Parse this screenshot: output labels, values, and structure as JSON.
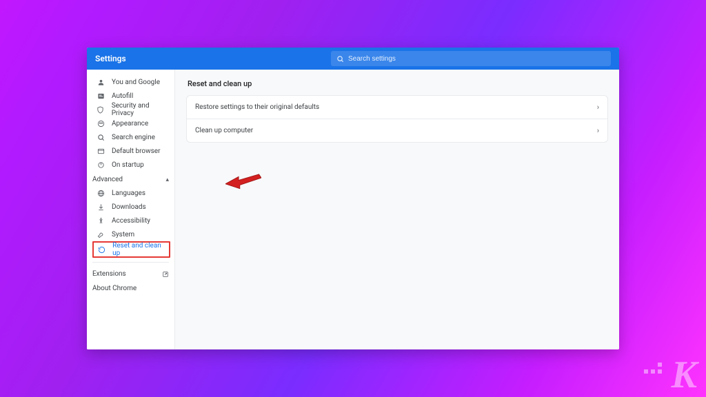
{
  "header": {
    "title": "Settings",
    "search_placeholder": "Search settings"
  },
  "sidebar": {
    "items": [
      {
        "icon": "person",
        "label": "You and Google"
      },
      {
        "icon": "autofill",
        "label": "Autofill"
      },
      {
        "icon": "shield",
        "label": "Security and Privacy"
      },
      {
        "icon": "appearance",
        "label": "Appearance"
      },
      {
        "icon": "search",
        "label": "Search engine"
      },
      {
        "icon": "browser",
        "label": "Default browser"
      },
      {
        "icon": "power",
        "label": "On startup"
      }
    ],
    "advanced_label": "Advanced",
    "advanced_items": [
      {
        "icon": "globe",
        "label": "Languages"
      },
      {
        "icon": "download",
        "label": "Downloads"
      },
      {
        "icon": "accessibility",
        "label": "Accessibility"
      },
      {
        "icon": "wrench",
        "label": "System"
      },
      {
        "icon": "restore",
        "label": "Reset and clean up",
        "active": true
      }
    ],
    "extensions_label": "Extensions",
    "about_label": "About Chrome"
  },
  "main": {
    "title": "Reset and clean up",
    "rows": [
      "Restore settings to their original defaults",
      "Clean up computer"
    ]
  },
  "watermark": "K"
}
